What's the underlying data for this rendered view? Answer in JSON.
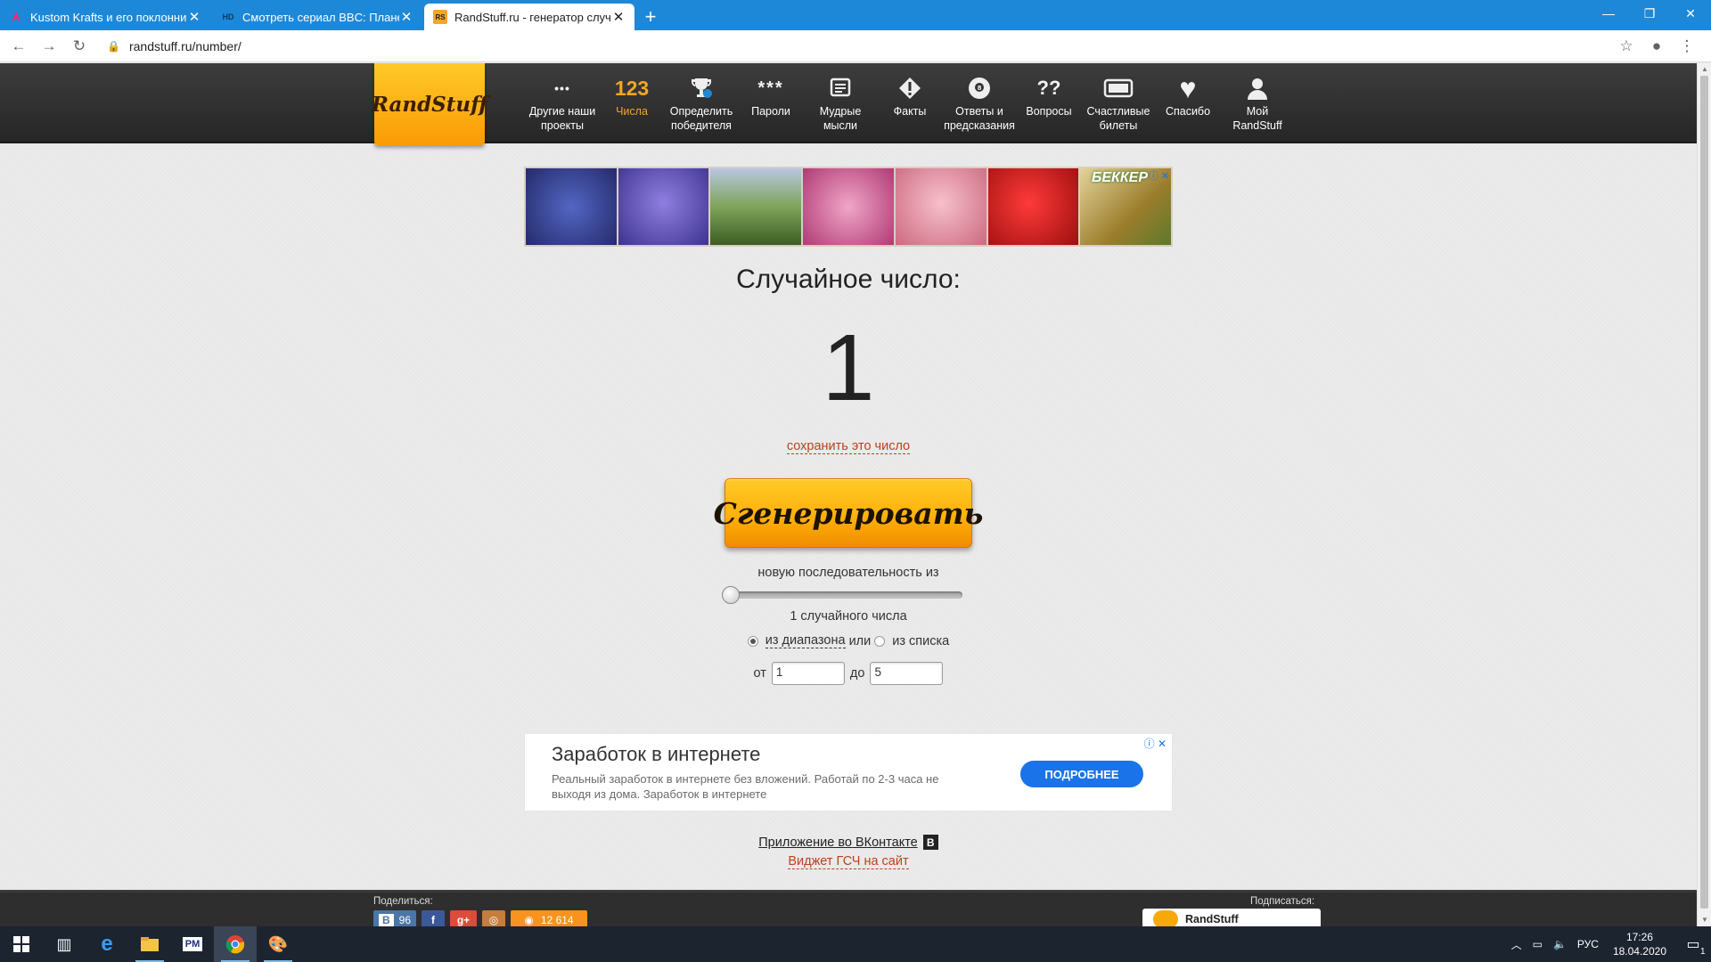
{
  "browser": {
    "tabs": [
      {
        "title": "Kustom Krafts и его поклонник...",
        "favicon": "pink-icon",
        "active": false
      },
      {
        "title": "Смотреть сериал BBC: Планета...",
        "favicon": "hd-icon",
        "favicon_text": "HD",
        "active": false
      },
      {
        "title": "RandStuff.ru - генератор случай...",
        "favicon": "randstuff-icon",
        "favicon_text": "RS",
        "active": true
      }
    ],
    "url": "randstuff.ru/number/",
    "window_controls": [
      "minimize-icon",
      "restore-icon",
      "close-icon"
    ]
  },
  "site": {
    "logo": "RandStuff",
    "menu": [
      {
        "icon": "dots-icon",
        "glyph": "•••",
        "label": "Другие наши проекты"
      },
      {
        "icon": "numbers-icon",
        "glyph": "123",
        "label": "Числа",
        "active": true
      },
      {
        "icon": "trophy-icon",
        "glyph": "🏆",
        "label": "Определить победителя"
      },
      {
        "icon": "password-icon",
        "glyph": "***",
        "label": "Пароли"
      },
      {
        "icon": "book-icon",
        "glyph": "▤",
        "label": "Мудрые мысли"
      },
      {
        "icon": "warning-icon",
        "glyph": "◆",
        "label": "Факты"
      },
      {
        "icon": "eight-ball-icon",
        "glyph": "●",
        "label": "Ответы и предсказания"
      },
      {
        "icon": "question-icon",
        "glyph": "??",
        "label": "Вопросы"
      },
      {
        "icon": "ticket-icon",
        "glyph": "▭",
        "label": "Счастливые билеты"
      },
      {
        "icon": "heart-icon",
        "glyph": "♥",
        "label": "Спасибо"
      },
      {
        "icon": "user-icon",
        "glyph": "👤",
        "label": "Мой RandStuff"
      }
    ]
  },
  "ad_top": {
    "brand": "БЕККЕР",
    "tiles": [
      "#36408a",
      "#5b4fb8",
      "#6b8f3f",
      "#c9598f",
      "#e38ea0",
      "#cf2424",
      "#9f8c43"
    ]
  },
  "main": {
    "heading": "Случайное число:",
    "result": "1",
    "save_link": "сохранить это число",
    "generate_button": "Сгенерировать",
    "sequence_label": "новую последовательность из",
    "slider_value": 1,
    "count_label": "1 случайного числа",
    "radio_range": "из диапазона",
    "or": "или",
    "radio_list": "из списка",
    "from_label": "от",
    "from_value": "1",
    "to_label": "до",
    "to_value": "5"
  },
  "ad_bottom": {
    "headline": "Заработок в интернете",
    "body": "Реальный заработок в интернете без вложений. Работай по 2-3 часа не выходя из дома. Заработок в интернете",
    "cta": "ПОДРОБНЕЕ"
  },
  "links": {
    "vk_app": "Приложение во ВКонтакте",
    "vk_badge": "B",
    "widget": "Виджет ГСЧ на сайт"
  },
  "footer": {
    "share_label": "Поделиться:",
    "subscribe_label": "Подписаться:",
    "vk_count": "96",
    "ok_count": "12 614",
    "subscribe_name": "RandStuff"
  },
  "taskbar": {
    "language": "РУС",
    "time": "17:26",
    "date": "18.04.2020",
    "notification_count": "1"
  },
  "colors": {
    "tab_bar": "#1e88d8",
    "accent_orange": "#f5a623",
    "link_red": "#b9411e",
    "ad_button": "#1a73e8"
  }
}
